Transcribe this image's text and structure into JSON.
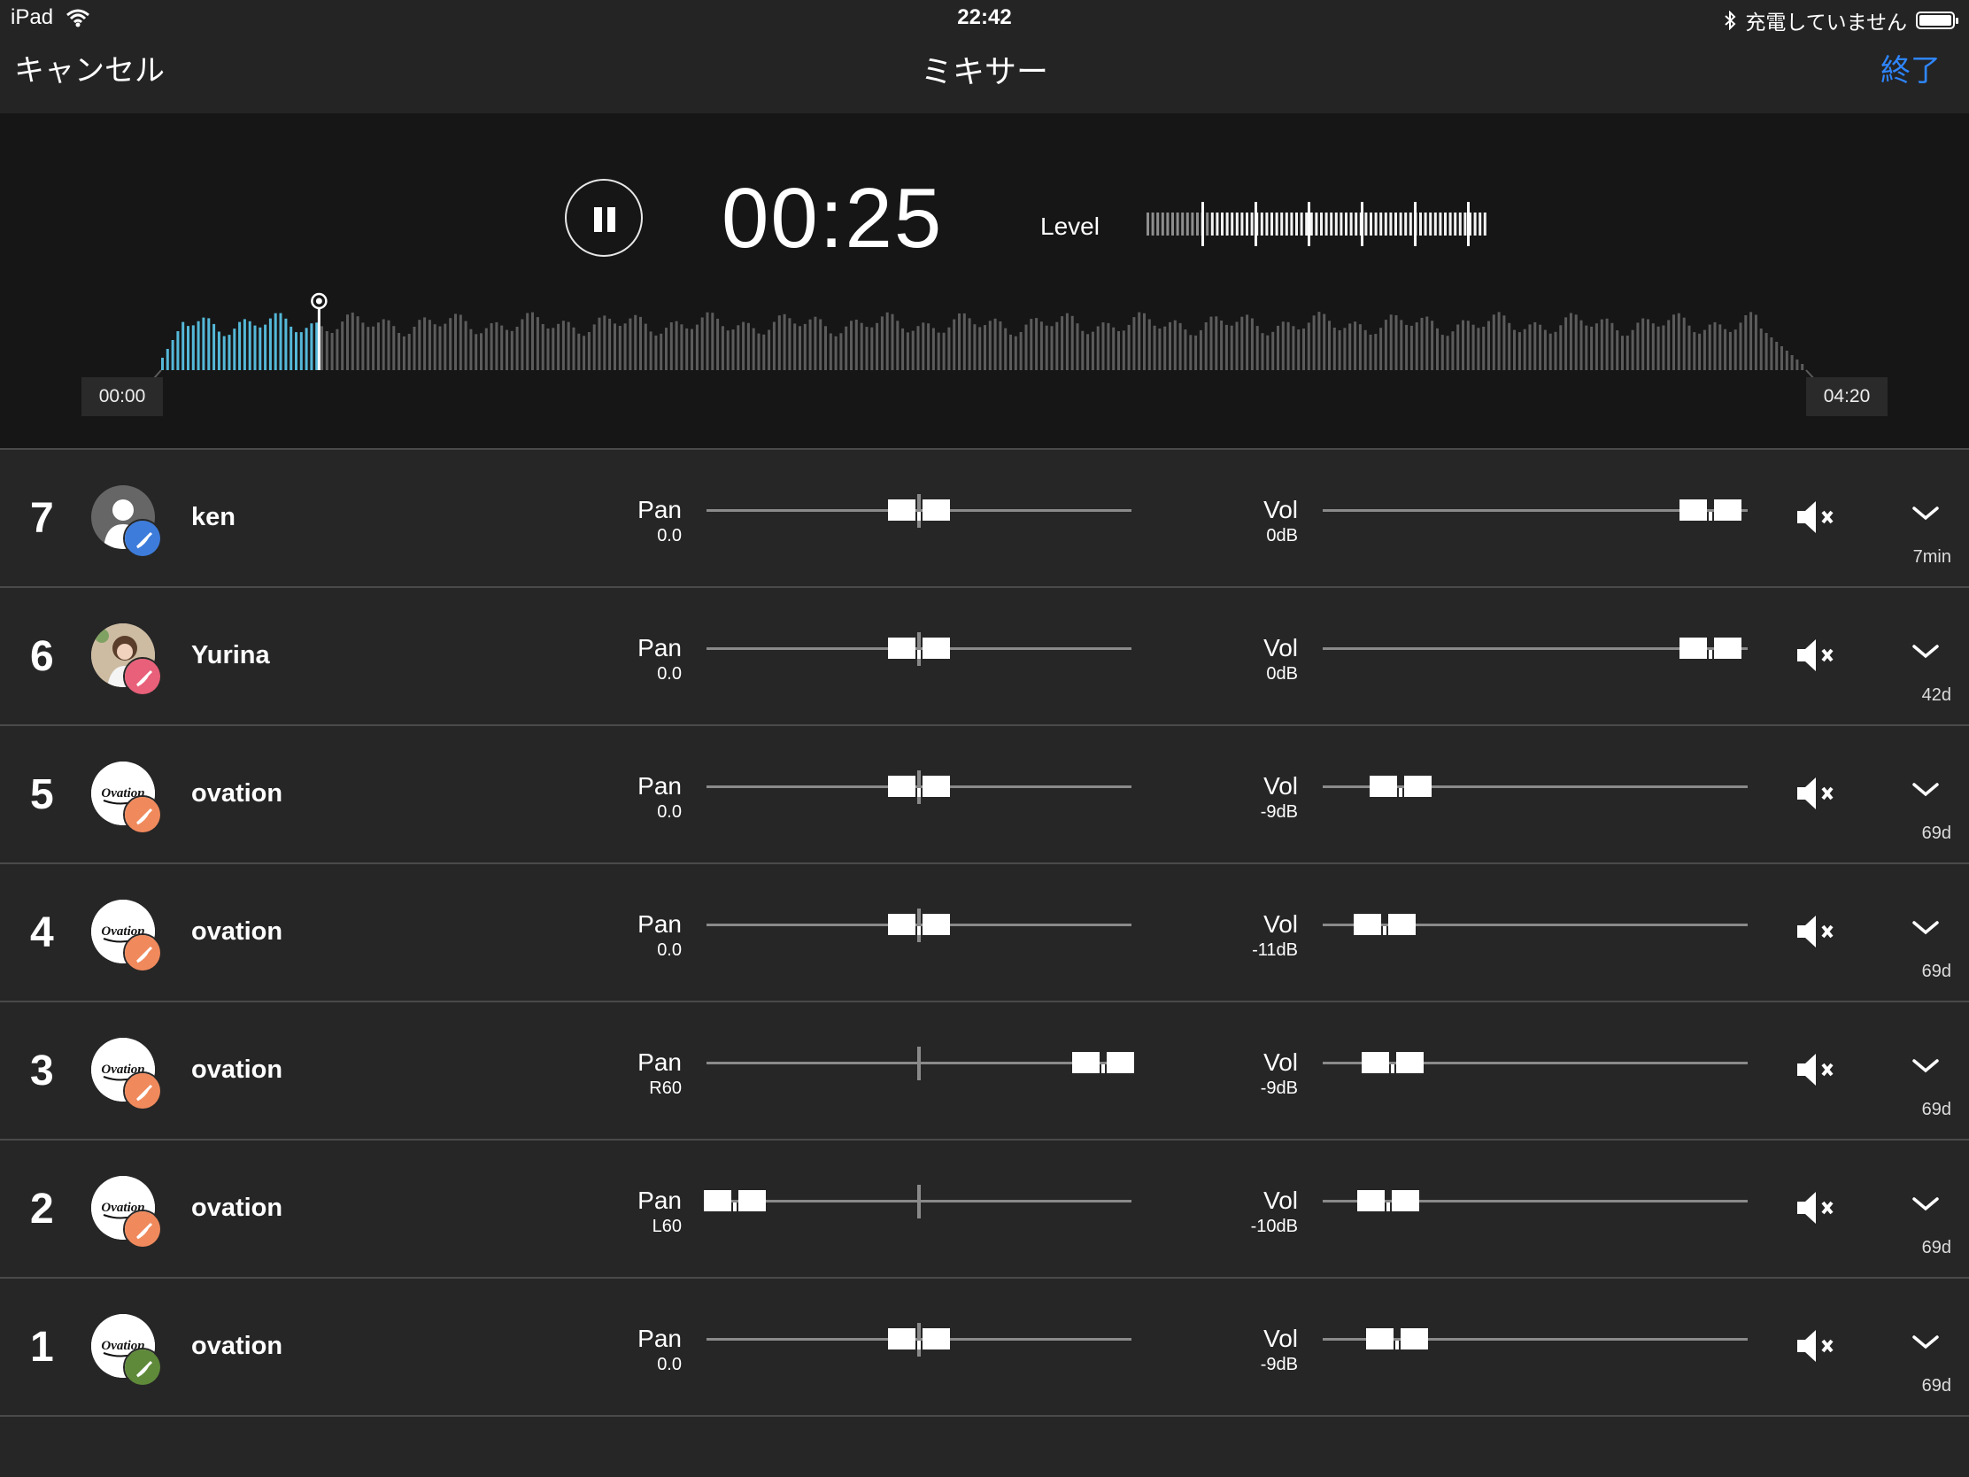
{
  "status": {
    "device": "iPad",
    "time": "22:42",
    "battery_text": "充電していません"
  },
  "nav": {
    "cancel": "キャンセル",
    "title": "ミキサー",
    "done": "終了"
  },
  "player": {
    "elapsed": "00:25",
    "level_label": "Level",
    "start_time": "00:00",
    "end_time": "04:20",
    "progress": 0.096
  },
  "tracks": [
    {
      "num": "7",
      "name": "ken",
      "pan_label": "Pan",
      "pan_value": "0.0",
      "pan": 0,
      "vol_label": "Vol",
      "vol_value": "0dB",
      "vol": 0.93,
      "ago": "7min",
      "avatar": "person",
      "badge": "blue"
    },
    {
      "num": "6",
      "name": "Yurina",
      "pan_label": "Pan",
      "pan_value": "0.0",
      "pan": 0,
      "vol_label": "Vol",
      "vol_value": "0dB",
      "vol": 0.93,
      "ago": "42d",
      "avatar": "photo",
      "badge": "pink"
    },
    {
      "num": "5",
      "name": "ovation",
      "pan_label": "Pan",
      "pan_value": "0.0",
      "pan": 0,
      "vol_label": "Vol",
      "vol_value": "-9dB",
      "vol": 0.17,
      "ago": "69d",
      "avatar": "ovation",
      "badge": "orange"
    },
    {
      "num": "4",
      "name": "ovation",
      "pan_label": "Pan",
      "pan_value": "0.0",
      "pan": 0,
      "vol_label": "Vol",
      "vol_value": "-11dB",
      "vol": 0.13,
      "ago": "69d",
      "avatar": "ovation",
      "badge": "orange"
    },
    {
      "num": "3",
      "name": "ovation",
      "pan_label": "Pan",
      "pan_value": "R60",
      "pan": 1,
      "vol_label": "Vol",
      "vol_value": "-9dB",
      "vol": 0.15,
      "ago": "69d",
      "avatar": "ovation",
      "badge": "orange"
    },
    {
      "num": "2",
      "name": "ovation",
      "pan_label": "Pan",
      "pan_value": "L60",
      "pan": -1,
      "vol_label": "Vol",
      "vol_value": "-10dB",
      "vol": 0.14,
      "ago": "69d",
      "avatar": "ovation",
      "badge": "orange"
    },
    {
      "num": "1",
      "name": "ovation",
      "pan_label": "Pan",
      "pan_value": "0.0",
      "pan": 0,
      "vol_label": "Vol",
      "vol_value": "-9dB",
      "vol": 0.16,
      "ago": "69d",
      "avatar": "ovation",
      "badge": "green"
    }
  ],
  "colors": {
    "accent": "#2f86ff",
    "played": "#55b8d8",
    "unplayed": "#5c5c5c"
  },
  "icons": {
    "pause": "pause-icon",
    "mute": "speaker-mute-icon",
    "expand": "chevron-down-icon",
    "wifi": "wifi-icon",
    "bluetooth": "bluetooth-icon",
    "battery": "battery-icon"
  }
}
